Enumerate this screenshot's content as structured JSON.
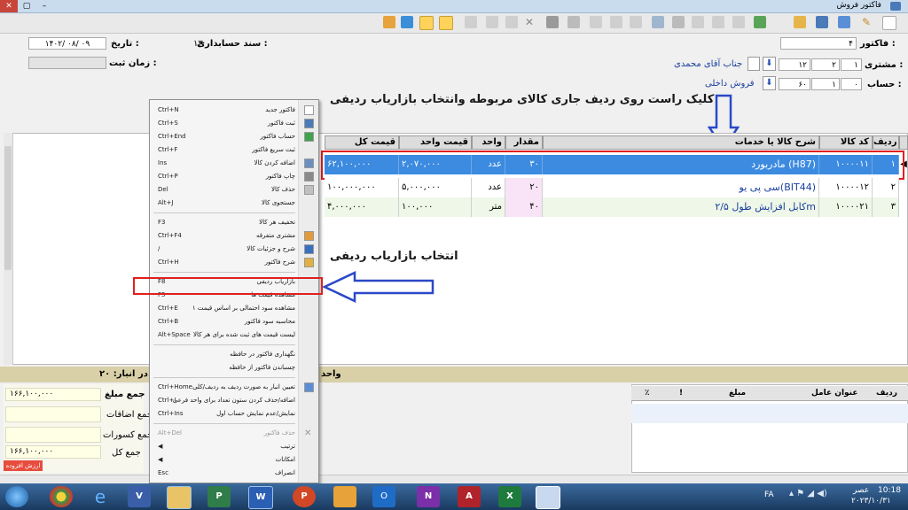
{
  "window": {
    "title": "فاکتور فروش"
  },
  "header": {
    "invoice_label": "فاکتور :",
    "invoice_value": "۴",
    "customer_label": "مشتری :",
    "customer_code": [
      "۱",
      "۲",
      "۱۲"
    ],
    "customer_name": "جناب آقای محمدی",
    "account_label": "حساب :",
    "account_code": [
      "۰",
      "۱",
      "۶۰"
    ],
    "account_name": "فروش داخلی",
    "doc_label": "سند حسابداری :",
    "doc_value": "۱۳",
    "date_label": "تاریخ :",
    "date_value": "۱۴۰۲/ ۰۸/ ۰۹",
    "reg_time_label": "زمان ثبت :"
  },
  "annotations": {
    "top": "کلیک راست روی ردیف جاری کالای مربوطه وانتخاب بازاریاب ردیفی",
    "middle": "انتخاب بازاریاب ردیفی"
  },
  "grid": {
    "columns": [
      "ردیف",
      "کد کالا",
      "شرح کالا یا خدمات",
      "مقدار",
      "واحد",
      "قیمت واحد",
      "قیمت کل"
    ],
    "rows": [
      {
        "row": "۱",
        "code": "۱۰۰۰۰۱۱",
        "desc": "مادربورد (H87)",
        "qty": "۳۰",
        "unit": "عدد",
        "price": "۲,۰۷۰,۰۰۰",
        "total": "۶۲,۱۰۰,۰۰۰"
      },
      {
        "row": "۲",
        "code": "۱۰۰۰۰۱۲",
        "desc": "سی پی یو(BIT44)",
        "qty": "۲۰",
        "unit": "عدد",
        "price": "۵,۰۰۰,۰۰۰",
        "total": "۱۰۰,۰۰۰,۰۰۰"
      },
      {
        "row": "۳",
        "code": "۱۰۰۰۰۲۱",
        "desc": "کابل افزایش طول ۲/۵m",
        "qty": "۴۰",
        "unit": "متر",
        "price": "۱۰۰,۰۰۰",
        "total": "۴,۰۰۰,۰۰۰"
      }
    ]
  },
  "context_menu": {
    "items": [
      {
        "label": "فاکتور جدید",
        "shortcut": "Ctrl+N",
        "icon": "new-doc-icon"
      },
      {
        "label": "ثبت فاکتور",
        "shortcut": "Ctrl+S",
        "icon": "save-icon"
      },
      {
        "label": "حساب فاکتور",
        "shortcut": "Ctrl+End",
        "icon": "money-icon"
      },
      {
        "label": "ثبت سریع فاکتور",
        "shortcut": "Ctrl+F",
        "icon": ""
      },
      {
        "label": "اضافه کردن کالا",
        "shortcut": "Ins",
        "icon": "add-row-icon"
      },
      {
        "label": "چاپ فاکتور",
        "shortcut": "Ctrl+P",
        "icon": "print-icon"
      },
      {
        "label": "حذف کالا",
        "shortcut": "Del",
        "icon": "delete-row-icon"
      },
      {
        "label": "جستجوی کالا",
        "shortcut": "Alt+J",
        "icon": ""
      },
      {
        "label": "تخفیف هر کالا",
        "shortcut": "F3",
        "icon": ""
      },
      {
        "label": "مشتری متفرقه",
        "shortcut": "Ctrl+F4",
        "icon": "person-icon"
      },
      {
        "label": "شرح و جزئیات کالا",
        "shortcut": "/",
        "icon": "edit-icon"
      },
      {
        "label": "شرح فاکتور",
        "shortcut": "Ctrl+H",
        "icon": "note-icon"
      },
      {
        "label": "بازاریاب ردیفی",
        "shortcut": "F8",
        "icon": ""
      },
      {
        "label": "مشاهده قیمت ها",
        "shortcut": "F5",
        "icon": ""
      },
      {
        "label": "مشاهده سود احتمالی بر اساس قیمت ۱",
        "shortcut": "Ctrl+E",
        "icon": ""
      },
      {
        "label": "محاسبه سود فاکتور",
        "shortcut": "Ctrl+B",
        "icon": ""
      },
      {
        "label": "لیست قیمت های ثبت شده برای هر کالا",
        "shortcut": "Alt+Space",
        "icon": ""
      },
      {
        "label": "نگهداری فاکتور در حافظه",
        "shortcut": "",
        "icon": ""
      },
      {
        "label": "چسباندن فاکتور از حافظه",
        "shortcut": "",
        "icon": ""
      },
      {
        "label": "تعیین انبار به صورت ردیف به ردیف/کلی",
        "shortcut": "Ctrl+Home",
        "icon": "grid-icon"
      },
      {
        "label": "اضافه/حذف کردن ستون تعداد برای واحد فرعی",
        "shortcut": "Ctrl+I",
        "icon": ""
      },
      {
        "label": "نمایش/عدم نمایش حساب اول",
        "shortcut": "Ctrl+Ins",
        "icon": ""
      },
      {
        "label": "حذف فاکتور",
        "shortcut": "Alt+Del",
        "icon": "close-x-icon",
        "disabled": true
      },
      {
        "label": "ترتیب",
        "shortcut": "",
        "icon": "",
        "submenu": true
      },
      {
        "label": "امکانات",
        "shortcut": "",
        "icon": "",
        "submenu": true
      },
      {
        "label": "انصراف",
        "shortcut": "Esc",
        "icon": ""
      }
    ]
  },
  "bottom": {
    "stock_label": "موجودی کالا در انبار: ۲۰-",
    "unit_label": "واحد",
    "sum_label": "جمع مبلغ :",
    "sum_value": "۱۶۶,۱۰۰,۰۰۰",
    "additions_label": "جمع اضافات",
    "deductions_label": "جمع کسورات",
    "total_label": "جمع کل",
    "total_value": "۱۶۶,۱۰۰,۰۰۰",
    "vat_label": "ارزش افزوده",
    "side_columns": [
      "ردیف",
      "عنوان عامل",
      "مبلغ",
      "!",
      "٪"
    ]
  },
  "taskbar": {
    "lang": "FA",
    "time": "10:18",
    "period": "عصر",
    "date": "۲۰۲۳/۱۰/۳۱"
  }
}
